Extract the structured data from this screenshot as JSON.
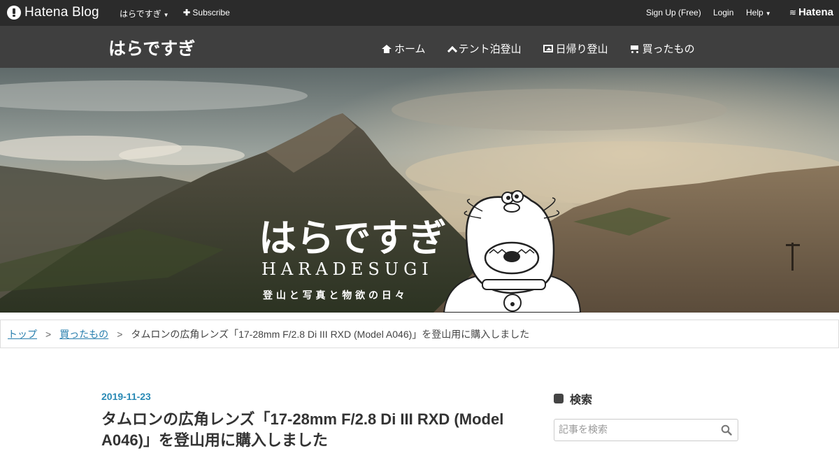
{
  "globalbar": {
    "brand": "Hatena Blog",
    "blog_menu": "はらですぎ",
    "subscribe": "Subscribe",
    "signup": "Sign Up (Free)",
    "login": "Login",
    "help": "Help",
    "hatena": "Hatena"
  },
  "header": {
    "blog_title": "はらですぎ",
    "nav": [
      {
        "label": "ホーム",
        "icon": "home-icon"
      },
      {
        "label": "テント泊登山",
        "icon": "chevron-up-icon"
      },
      {
        "label": "日帰り登山",
        "icon": "picture-icon"
      },
      {
        "label": "買ったもの",
        "icon": "cart-icon"
      }
    ]
  },
  "hero": {
    "logo_text": "はらですぎ",
    "logo_sub": "HARADESUGI",
    "tagline": "登 山 と 写 真 と 物 欲 の 日 々"
  },
  "breadcrumb": {
    "top": "トップ",
    "category": "買ったもの",
    "current": "タムロンの広角レンズ「17-28mm F/2.8 Di III RXD (Model A046)」を登山用に購入しました",
    "separator": ">"
  },
  "entry": {
    "date": "2019-11-23",
    "title": "タムロンの広角レンズ「17-28mm F/2.8 Di III RXD (Model A046)」を登山用に購入しました"
  },
  "sidebar": {
    "search_title": "検索",
    "search_placeholder": "記事を検索"
  },
  "colors": {
    "globalbar_bg": "#2b2b2b",
    "header_bg": "#3f3f3f",
    "link": "#2a7fae",
    "date": "#2a8ab5"
  }
}
